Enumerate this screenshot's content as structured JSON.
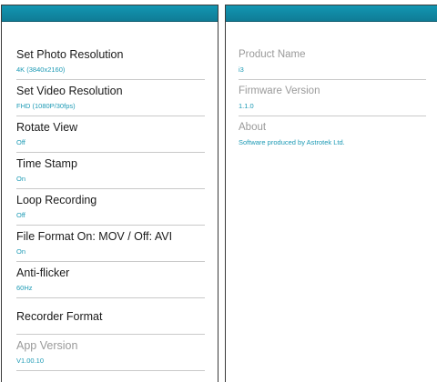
{
  "theme": {
    "header_color": "#1189a5",
    "value_color": "#1d9ab5",
    "divider_color": "#c9c9c9"
  },
  "settings": {
    "items": [
      {
        "label": "Set Photo Resolution",
        "value": "4K (3840x2160)"
      },
      {
        "label": "Set Video Resolution",
        "value": "FHD (1080P/30fps)"
      },
      {
        "label": "Rotate View",
        "value": "Off"
      },
      {
        "label": "Time Stamp",
        "value": "On"
      },
      {
        "label": "Loop Recording",
        "value": "Off"
      },
      {
        "label": "File Format On: MOV / Off: AVI",
        "value": "On"
      },
      {
        "label": "Anti-flicker",
        "value": "60Hz"
      },
      {
        "label": "Recorder Format"
      },
      {
        "label": "App Version",
        "value": "V1.00.10"
      }
    ]
  },
  "about": {
    "items": [
      {
        "label": "Product Name",
        "value": "i3"
      },
      {
        "label": "Firmware Version",
        "value": "1.1.0"
      },
      {
        "label": "About",
        "value": "Software produced by Astrotek Ltd."
      }
    ]
  }
}
